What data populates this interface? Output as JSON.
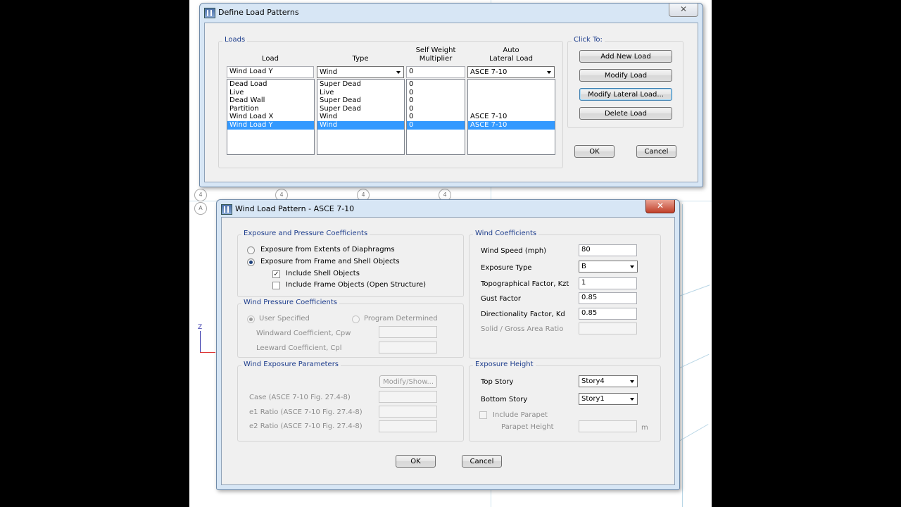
{
  "dialog1": {
    "title": "Define Load Patterns",
    "close_glyph": "✕",
    "loads_group": "Loads",
    "headers": {
      "load": "Load",
      "type": "Type",
      "self_weight": "Self Weight\nMultiplier",
      "auto_lateral": "Auto\nLateral Load"
    },
    "inputs": {
      "load": "Wind Load Y",
      "type": "Wind",
      "multiplier": "0",
      "auto_lateral": "ASCE 7-10"
    },
    "rows": [
      {
        "load": "Dead Load",
        "type": "Super Dead",
        "mult": "0",
        "auto": ""
      },
      {
        "load": "Live",
        "type": "Live",
        "mult": "0",
        "auto": ""
      },
      {
        "load": "Dead Wall",
        "type": "Super Dead",
        "mult": "0",
        "auto": ""
      },
      {
        "load": "Partition",
        "type": "Super Dead",
        "mult": "0",
        "auto": ""
      },
      {
        "load": "Wind Load X",
        "type": "Wind",
        "mult": "0",
        "auto": "ASCE 7-10"
      },
      {
        "load": "Wind Load Y",
        "type": "Wind",
        "mult": "0",
        "auto": "ASCE 7-10"
      }
    ],
    "selected_row": 5,
    "click_to_group": "Click To:",
    "buttons": {
      "add": "Add New Load",
      "modify": "Modify Load",
      "modify_lateral": "Modify Lateral Load...",
      "delete": "Delete Load",
      "ok": "OK",
      "cancel": "Cancel"
    }
  },
  "grid_bubbles": [
    "4",
    "4",
    "4",
    "4",
    "A"
  ],
  "axis_label": "Z",
  "dialog2": {
    "title": "Wind Load Pattern - ASCE 7-10",
    "close_glyph": "✕",
    "exposure_group": {
      "title": "Exposure and Pressure Coefficients",
      "radio_diaphragms": "Exposure from Extents of Diaphragms",
      "radio_frame_shell": "Exposure from Frame and Shell Objects",
      "check_shell": "Include Shell Objects",
      "check_frame": "Include Frame Objects (Open Structure)"
    },
    "pressure_group": {
      "title": "Wind Pressure Coefficients",
      "user_specified": "User Specified",
      "program_determined": "Program Determined",
      "windward": "Windward Coefficient, Cpw",
      "leeward": "Leeward Coefficient, Cpl"
    },
    "exposure_params_group": {
      "title": "Wind Exposure Parameters",
      "modify_show": "Modify/Show...",
      "case": "Case  (ASCE 7-10 Fig. 27.4-8)",
      "e1": "e1 Ratio  (ASCE 7-10 Fig. 27.4-8)",
      "e2": "e2 Ratio  (ASCE 7-10 Fig. 27.4-8)"
    },
    "wind_coeff_group": {
      "title": "Wind Coefficients",
      "wind_speed_label": "Wind Speed (mph)",
      "wind_speed": "80",
      "exposure_type_label": "Exposure Type",
      "exposure_type": "B",
      "kzt_label": "Topographical Factor, Kzt",
      "kzt": "1",
      "gust_label": "Gust Factor",
      "gust": "0.85",
      "kd_label": "Directionality Factor, Kd",
      "kd": "0.85",
      "solid_gross_label": "Solid / Gross Area Ratio"
    },
    "exposure_height_group": {
      "title": "Exposure Height",
      "top_story_label": "Top Story",
      "top_story": "Story4",
      "bottom_story_label": "Bottom Story",
      "bottom_story": "Story1",
      "include_parapet": "Include Parapet",
      "parapet_height": "Parapet Height",
      "unit": "m"
    },
    "buttons": {
      "ok": "OK",
      "cancel": "Cancel"
    }
  }
}
